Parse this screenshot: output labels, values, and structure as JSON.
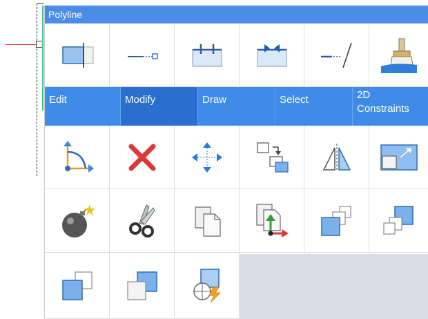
{
  "palette": {
    "title": "Polyline",
    "tabs": [
      {
        "label": "Edit",
        "active": false
      },
      {
        "label": "Modify",
        "active": true
      },
      {
        "label": "Draw",
        "active": false
      },
      {
        "label": "Select",
        "active": false
      },
      {
        "label": "2D Constraints",
        "active": false
      }
    ],
    "top_tools": [
      "polyline-width-icon",
      "line-endpoint-icon",
      "break-icon",
      "join-icon",
      "extend-icon",
      "match-properties-icon"
    ],
    "modify_tools": [
      "fillet-icon",
      "erase-icon",
      "move-icon",
      "copy-icon",
      "mirror-icon",
      "scale-icon",
      "explode-icon",
      "trim-icon",
      "paste-icon",
      "paste-to-point-icon",
      "bring-to-front-icon",
      "send-to-back-icon",
      "bring-above-icon",
      "send-under-icon",
      "quick-select-icon"
    ],
    "colors": {
      "accent": "#4a8ce6",
      "active_tab": "#2a6fd0",
      "empty_area": "#dcdce8"
    }
  }
}
